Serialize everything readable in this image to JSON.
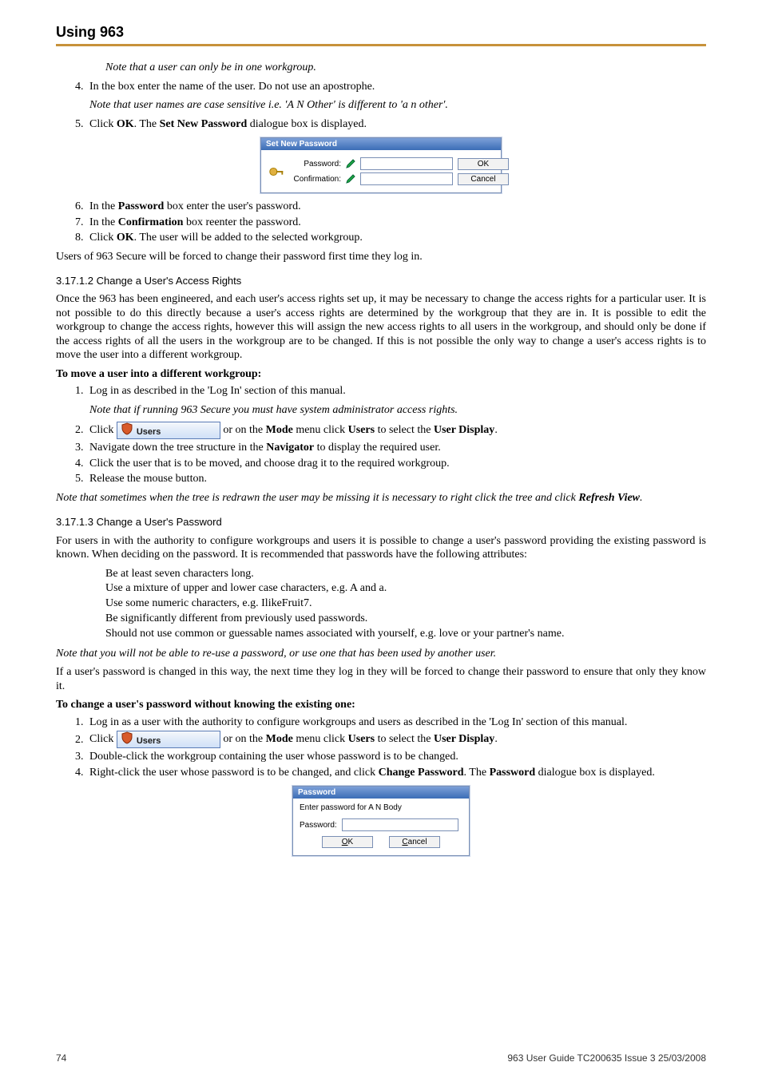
{
  "header": {
    "title": "Using 963"
  },
  "noteWorkgroup": "Note that a user can only be in one workgroup.",
  "step4": {
    "text": "In the box enter the name of the user. Do not use an apostrophe.",
    "note": "Note that user names are case sensitive i.e. 'A N Other' is different to 'a n other'."
  },
  "step5": {
    "prefix": "Click ",
    "ok": "OK",
    "mid": ". The ",
    "dlg": "Set New Password",
    "suffix": " dialogue box is displayed."
  },
  "setNewPwdDialog": {
    "title": "Set New Password",
    "passwordLabel": "Password:",
    "confirmLabel": "Confirmation:",
    "okBtn": "OK",
    "cancelBtn": "Cancel"
  },
  "step6": {
    "a": "In the ",
    "b": "Password",
    "c": " box enter the user's password."
  },
  "step7": {
    "a": "In the ",
    "b": "Confirmation",
    "c": " box reenter the password."
  },
  "step8": {
    "a": "Click ",
    "b": "OK",
    "c": ". The user will be added to the selected workgroup."
  },
  "secureLine": "Users of 963 Secure will be forced to change their password first time they log in.",
  "section2": {
    "heading": "3.17.1.2  Change a User's Access Rights",
    "para": "Once the 963 has been engineered, and each user's access rights set up, it may be necessary to change the access rights for a particular user. It is not possible to do this directly because a user's access rights are determined by the workgroup that they are in. It is possible to edit the workgroup to change the access rights, however this will assign the new access rights to all users in the workgroup, and should only be done if the access rights of all the users in the workgroup are to be changed. If this is not possible the only way to change a user's access rights is to move the user into a different workgroup.",
    "moveHeading": "To move a user into a different workgroup:",
    "s1": "Log in as described in the 'Log In' section of this manual.",
    "s1note": "Note that if running 963 Secure you must have system administrator access rights.",
    "usersBtn": "Users",
    "s2a": "Click ",
    "s2b": " or on the ",
    "s2Mode": "Mode",
    "s2c": " menu click ",
    "s2Users": "Users",
    "s2d": " to select the ",
    "s2UD": "User Display",
    "s2e": ".",
    "s3a": "Navigate down the tree structure in the ",
    "s3Nav": "Navigator",
    "s3b": " to display the required user.",
    "s4": "Click the user that is to be moved, and choose drag it to the required workgroup.",
    "s5": "Release the mouse button.",
    "noteRefresh1": "Note that sometimes when the tree is redrawn the user may be missing it is necessary to right click the tree and click ",
    "noteRefresh2": "Refresh View",
    "noteRefresh3": "."
  },
  "section3": {
    "heading": "3.17.1.3  Change a User's Password",
    "para1": "For users in with the authority to configure workgroups and users it is possible to change a user's password providing the existing password is known. When deciding on the password. It is recommended that passwords have the following attributes:",
    "b1": "Be at least seven characters long.",
    "b2": "Use a mixture of upper and lower case characters, e.g. A and a.",
    "b3": "Use some numeric characters, e.g. IlikeFruit7.",
    "b4": "Be significantly different from previously used passwords.",
    "b5": "Should not use common or guessable names associated with yourself, e.g. love or your partner's name.",
    "noteReuse": "Note that you will not be able to re-use a password, or use one that has been used by another user.",
    "para2": "If a user's password is changed in this way, the next time they log in they will be forced to change their password to ensure that only they know it.",
    "changeHeading": "To change a user's password without knowing the existing one:",
    "cs1": "Log in as a user with the authority to configure workgroups and users as described in the 'Log In' section of this manual.",
    "cs2a": "Click ",
    "cs2b": " or on the ",
    "cs2Mode": "Mode",
    "cs2c": " menu click ",
    "cs2Users": "Users",
    "cs2d": " to select the ",
    "cs2UD": "User Display",
    "cs2e": ".",
    "cs3": "Double-click the workgroup containing the user whose password is to be changed.",
    "cs4a": "Right-click the user whose password is to be changed, and click ",
    "cs4b": "Change Password",
    "cs4c": ". The ",
    "cs4d": "Password",
    "cs4e": " dialogue box is displayed."
  },
  "pwdDialog": {
    "title": "Password",
    "prompt": "Enter password for A N Body",
    "passwordLabel": "Password:",
    "okBtn": "OK",
    "cancelBtn": "Cancel"
  },
  "footer": {
    "pageNo": "74",
    "docId": "963 User Guide TC200635 Issue 3 25/03/2008"
  }
}
